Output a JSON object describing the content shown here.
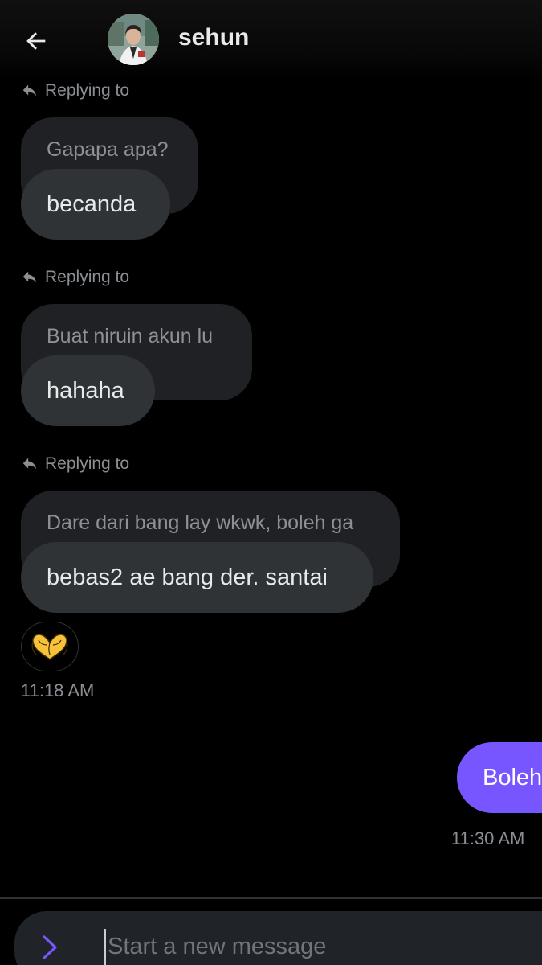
{
  "header": {
    "contact_name": "sehun",
    "back_icon": "arrow-left-icon",
    "avatar_icon": "profile-avatar"
  },
  "messages": [
    {
      "reply_label": "Replying to",
      "quoted_text": "Gapapa apa?",
      "text": "becanda"
    },
    {
      "reply_label": "Replying to",
      "quoted_text": "Buat niruin akun lu",
      "text": "hahaha"
    },
    {
      "reply_label": "Replying to",
      "quoted_text": "Dare dari bang lay wkwk, boleh ga",
      "text": "bebas2 ae bang der. santai"
    }
  ],
  "reaction": {
    "emoji_icon": "heart-hands-icon",
    "emoji": "🫶"
  },
  "received_time": "11:18 AM",
  "sent": {
    "text": "Boleh",
    "time": "11:30 AM"
  },
  "composer": {
    "placeholder": "Start a new message",
    "expand_icon": "chevron-right-icon"
  },
  "colors": {
    "background": "#000000",
    "received_bubble": "#2f3336",
    "quoted_bubble": "#202124",
    "sent_bubble": "#7856ff",
    "muted_text": "#8b8f94"
  }
}
